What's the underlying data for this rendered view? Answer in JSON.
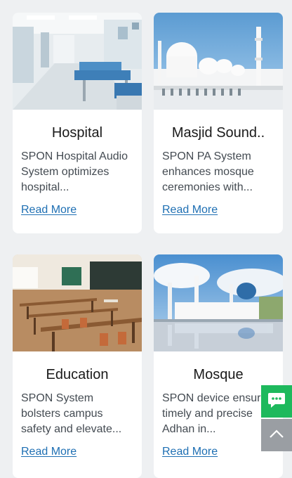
{
  "cards": [
    {
      "title": "Hospital",
      "description": "SPON Hospital Audio System optimizes hospital...",
      "link": "Read More",
      "image": "hospital-corridor-image"
    },
    {
      "title": "Masjid Sound..",
      "description": "SPON PA System enhances mosque ceremonies with...",
      "link": "Read More",
      "image": "masjid-image"
    },
    {
      "title": "Education",
      "description": "SPON System bolsters campus safety and elevate...",
      "link": "Read More",
      "image": "classroom-image"
    },
    {
      "title": "Mosque",
      "description": "SPON device ensures timely and precise Adhan in...",
      "link": "Read More",
      "image": "mosque-lake-image"
    }
  ],
  "floating": {
    "chat_icon": "chat-icon",
    "top_icon": "chevron-up-icon",
    "chat_color": "#1eb95d",
    "top_color": "#9a9ea3"
  },
  "colors": {
    "link": "#1e6fb3",
    "background": "#eef0f2"
  }
}
